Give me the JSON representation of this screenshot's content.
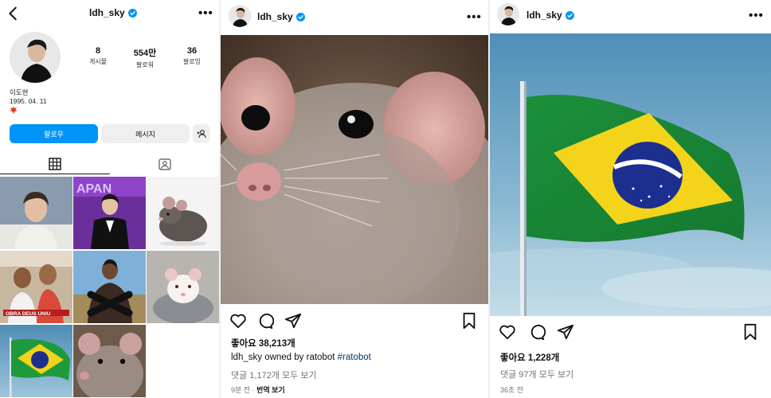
{
  "profile": {
    "username": "ldh_sky",
    "stats": [
      {
        "value": "8",
        "label": "게시물"
      },
      {
        "value": "554만",
        "label": "팔로워"
      },
      {
        "value": "36",
        "label": "팔로잉"
      }
    ],
    "name": "이도현",
    "birthday": "1995. 04. 11",
    "follow_label": "팔로우",
    "message_label": "메시지",
    "colors": {
      "follow": "#0095f6",
      "verified": "#0095f6"
    }
  },
  "post_rat": {
    "username": "ldh_sky",
    "likes": "좋아요 38,213개",
    "caption_user": "ldh_sky",
    "caption_text": " owned by ratobot ",
    "caption_tag": "#ratobot",
    "comments": "댓글 1,172개 모두 보기",
    "time": "9분 전",
    "translate": "번역 보기"
  },
  "post_flag": {
    "username": "ldh_sky",
    "likes": "좋아요 1,228개",
    "comments": "댓글 97개 모두 보기",
    "time": "36초 전"
  }
}
